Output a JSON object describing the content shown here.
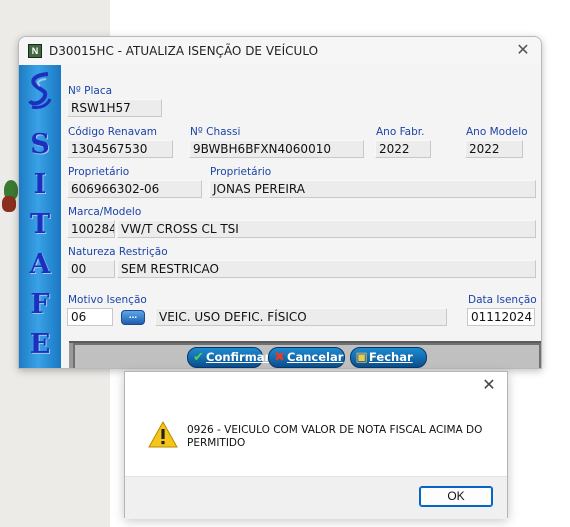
{
  "window": {
    "title": "D30015HC - ATUALIZA ISENÇÃO DE VEÍCULO",
    "app_icon_letter": "N",
    "close_glyph": "✕"
  },
  "brand": {
    "letters": [
      "S",
      "I",
      "T",
      "A",
      "F",
      "E"
    ]
  },
  "form": {
    "placa": {
      "label": "Nº Placa",
      "value": "RSW1H57"
    },
    "renavam": {
      "label": "Código Renavam",
      "value": "1304567530"
    },
    "chassi": {
      "label": "Nº Chassi",
      "value": "9BWBH6BFXN4060010"
    },
    "ano_fabr": {
      "label": "Ano Fabr.",
      "value": "2022"
    },
    "ano_modelo": {
      "label": "Ano Modelo",
      "value": "2022"
    },
    "proprietario_doc": {
      "label": "Proprietário",
      "value": "606966302-06"
    },
    "proprietario_nome": {
      "label": "Proprietário",
      "value": "JONAS PEREIRA"
    },
    "marca_modelo": {
      "label": "Marca/Modelo",
      "code": "100284",
      "desc": "VW/T CROSS CL TSI"
    },
    "natureza": {
      "label": "Natureza Restrição",
      "code": "00",
      "desc": "SEM RESTRICAO"
    },
    "motivo": {
      "label": "Motivo Isenção",
      "code": "06",
      "lookup_label": "...",
      "desc": "VEIC. USO DEFIC. FÍSICO"
    },
    "data_isencao": {
      "label": "Data Isenção",
      "value": "01112024"
    }
  },
  "buttons": {
    "confirmar": "Confirmar",
    "cancelar": "Cancelar",
    "fechar": "Fechar"
  },
  "alert": {
    "close_glyph": "✕",
    "message": "0926 - VEICULO COM VALOR DE NOTA FISCAL ACIMA DO PERMITIDO",
    "ok_label": "OK",
    "icon": "warning-icon"
  },
  "colors": {
    "label_blue": "#1b44a8",
    "brand_blue": "#2a90d8",
    "button_blue": "#0b4f8e"
  }
}
